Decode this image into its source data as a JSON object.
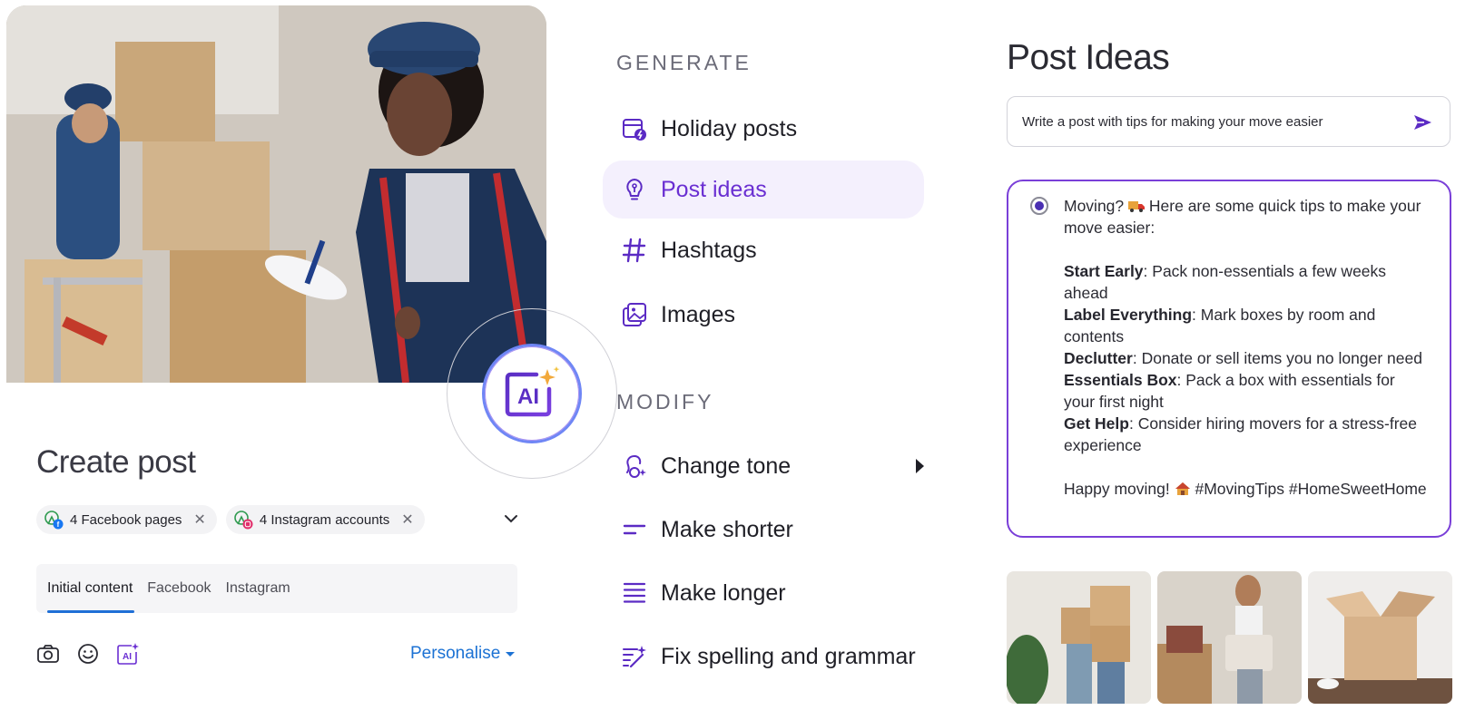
{
  "hero": {
    "image": "delivery-worker-photo"
  },
  "ai_badge": {
    "label": "AI"
  },
  "create_post": {
    "title": "Create post",
    "chips": [
      {
        "label": "4 Facebook pages",
        "icon": "facebook-pages-icon"
      },
      {
        "label": "4 Instagram accounts",
        "icon": "instagram-accounts-icon"
      }
    ],
    "tabs": [
      {
        "label": "Initial content",
        "active": true
      },
      {
        "label": "Facebook",
        "active": false
      },
      {
        "label": "Instagram",
        "active": false
      }
    ],
    "toolbar": {
      "icons": [
        "camera-icon",
        "emoji-icon",
        "ai-icon"
      ],
      "personalise_label": "Personalise"
    }
  },
  "menu": {
    "generate_label": "GENERATE",
    "generate_items": [
      {
        "label": "Holiday posts",
        "icon": "holiday-calendar-icon",
        "active": false
      },
      {
        "label": "Post ideas",
        "icon": "lightbulb-icon",
        "active": true
      },
      {
        "label": "Hashtags",
        "icon": "hashtag-icon",
        "active": false
      },
      {
        "label": "Images",
        "icon": "image-icon",
        "active": false
      }
    ],
    "modify_label": "MODIFY",
    "modify_items": [
      {
        "label": "Change tone",
        "icon": "tone-icon",
        "has_submenu": true
      },
      {
        "label": "Make shorter",
        "icon": "shorter-icon"
      },
      {
        "label": "Make longer",
        "icon": "longer-icon"
      },
      {
        "label": "Fix spelling and grammar",
        "icon": "spelling-icon"
      }
    ]
  },
  "post_ideas": {
    "title": "Post Ideas",
    "prompt_value": "Write a post with tips for making your move easier",
    "idea": {
      "intro_a": "Moving?",
      "intro_b": "Here are some quick tips to make your move easier:",
      "tips": [
        {
          "bold": "Start Early",
          "text": ": Pack non-essentials a few weeks ahead"
        },
        {
          "bold": "Label Everything",
          "text": ": Mark boxes by room and contents"
        },
        {
          "bold": "Declutter",
          "text": ": Donate or sell items you no longer need"
        },
        {
          "bold": "Essentials Box",
          "text": ": Pack a box with essentials for your first night"
        },
        {
          "bold": "Get Help",
          "text": ": Consider hiring movers for a stress-free experience"
        }
      ],
      "closing_a": "Happy moving!",
      "closing_b": "#MovingTips #HomeSweetHome"
    },
    "thumbnails": [
      "couple-carrying-boxes-photo",
      "woman-carrying-boxes-photo",
      "open-cardboard-box-photo"
    ]
  },
  "colors": {
    "accent": "#6a2fd2",
    "link": "#1c72d4",
    "active_bg": "#f4f0fd"
  }
}
